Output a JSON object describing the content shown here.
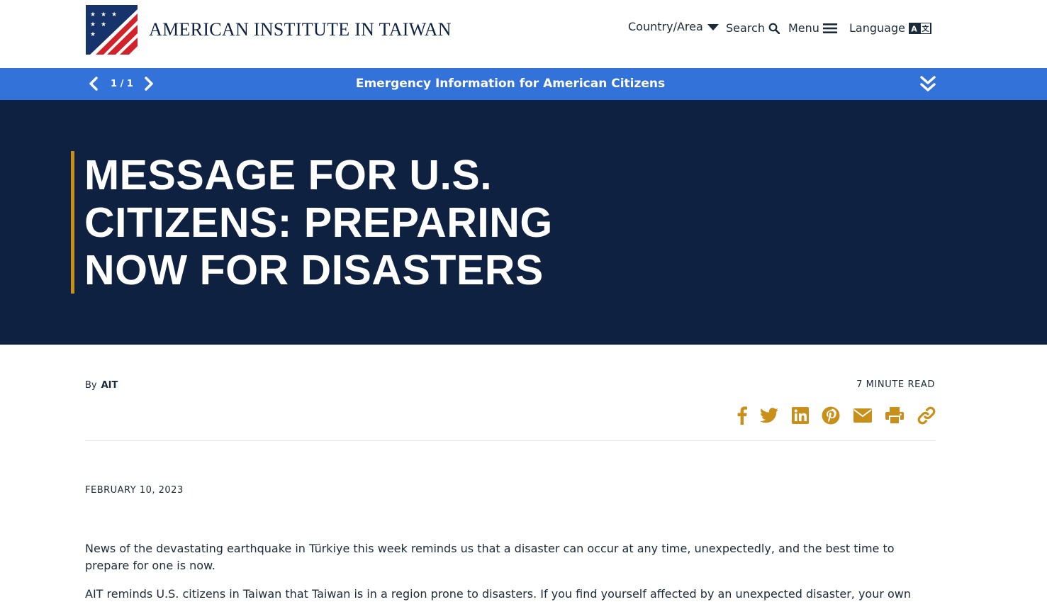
{
  "header": {
    "site_title": "AMERICAN INSTITUTE IN TAIWAN",
    "nav": {
      "country": "Country/Area",
      "search": "Search",
      "menu": "Menu",
      "language": "Language"
    }
  },
  "alert": {
    "counter": "1 / 1",
    "text": "Emergency Information for American Citizens"
  },
  "hero": {
    "title": "MESSAGE FOR U.S. CITIZENS: PREPARING NOW FOR DISASTERS"
  },
  "meta": {
    "by_label": "By",
    "author": "AIT",
    "read_time": "7 MINUTE READ"
  },
  "share_icons": [
    "facebook-icon",
    "twitter-icon",
    "linkedin-icon",
    "pinterest-icon",
    "email-icon",
    "print-icon",
    "link-icon"
  ],
  "article": {
    "date": "FEBRUARY 10, 2023",
    "paragraphs": [
      "News of the devastating earthquake in Türkiye this week reminds us that a disaster can occur at any time, unexpectedly, and the best time to prepare for one is now.",
      "AIT reminds U.S. citizens in Taiwan that Taiwan is in a region prone to disasters. If you find yourself affected by an unexpected disaster, your own"
    ]
  },
  "colors": {
    "navy": "#0f2141",
    "alert_blue": "#3372d9",
    "gold": "#c8901a",
    "flag_red": "#d2232a"
  }
}
